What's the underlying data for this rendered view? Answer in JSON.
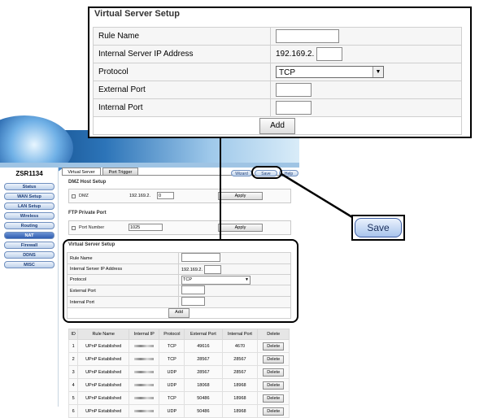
{
  "sidebar": {
    "model": "ZSR1134",
    "items": [
      "Status",
      "WAN Setup",
      "LAN Setup",
      "Wireless",
      "Routing",
      "NAT",
      "Firewall",
      "DDNS",
      "MISC"
    ],
    "active": "NAT"
  },
  "tabs": [
    {
      "label": "Virtual Server",
      "active": true
    },
    {
      "label": "Port Trigger",
      "active": false
    }
  ],
  "toolbar": {
    "wizard": "Wizard",
    "save": "Save",
    "help": "Help"
  },
  "dmz": {
    "title": "DMZ Host Setup",
    "checkbox_label": "DMZ",
    "ip_prefix": "192.169.2.",
    "ip_value": "0",
    "apply": "Apply"
  },
  "ftp": {
    "title": "FTP Private Port",
    "checkbox_label": "Port Number",
    "port_value": "1025",
    "apply": "Apply"
  },
  "virtual_server": {
    "title": "Virtual Server Setup",
    "rule_name": "Rule Name",
    "internal_ip": "Internal Server IP Address",
    "ip_prefix": "192.169.2.",
    "protocol": "Protocol",
    "protocol_value": "TCP",
    "external_port": "External Port",
    "internal_port": "Internal Port",
    "add": "Add"
  },
  "list": {
    "headers": [
      "ID",
      "Rule Name",
      "Internal IP",
      "Protocol",
      "External Port",
      "Internal Port",
      "Delete"
    ],
    "rows": [
      {
        "id": "1",
        "rule": "UPnP Established",
        "protocol": "TCP",
        "ext": "49616",
        "int": "4670",
        "del": "Delete"
      },
      {
        "id": "2",
        "rule": "UPnP Established",
        "protocol": "TCP",
        "ext": "28567",
        "int": "28567",
        "del": "Delete"
      },
      {
        "id": "3",
        "rule": "UPnP Established",
        "protocol": "UDP",
        "ext": "28567",
        "int": "28567",
        "del": "Delete"
      },
      {
        "id": "4",
        "rule": "UPnP Established",
        "protocol": "UDP",
        "ext": "18068",
        "int": "18968",
        "del": "Delete"
      },
      {
        "id": "5",
        "rule": "UPnP Established",
        "protocol": "TCP",
        "ext": "50486",
        "int": "18968",
        "del": "Delete"
      },
      {
        "id": "6",
        "rule": "UPnP Established",
        "protocol": "UDP",
        "ext": "50486",
        "int": "18968",
        "del": "Delete"
      }
    ]
  },
  "callout_save": "Save"
}
